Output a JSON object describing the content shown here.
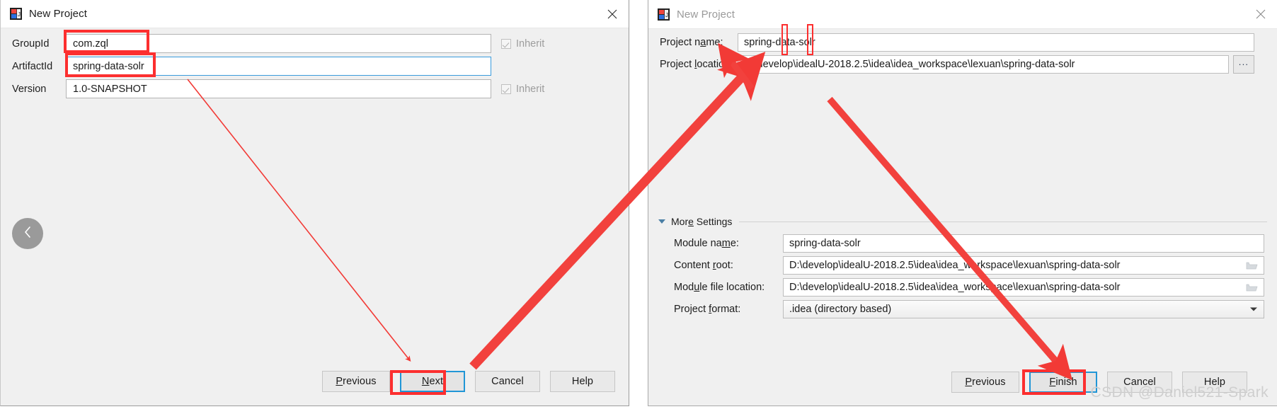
{
  "left_dialog": {
    "title": "New Project",
    "title_icon": "intellij-idea-icon",
    "close_icon": "close-icon",
    "back_icon": "chevron-left-icon",
    "fields": [
      {
        "label": "GroupId",
        "value": "com.zql",
        "inherit_label": "Inherit",
        "has_inherit": true,
        "focused": false
      },
      {
        "label": "ArtifactId",
        "value": "spring-data-solr",
        "inherit_label": "",
        "has_inherit": false,
        "focused": true
      },
      {
        "label": "Version",
        "value": "1.0-SNAPSHOT",
        "inherit_label": "Inherit",
        "has_inherit": true,
        "focused": false
      }
    ],
    "buttons": [
      {
        "label": "Previous",
        "mnemonic": "P",
        "focused": false
      },
      {
        "label": "Next",
        "mnemonic": "N",
        "focused": true
      },
      {
        "label": "Cancel",
        "mnemonic": "",
        "focused": false
      },
      {
        "label": "Help",
        "mnemonic": "",
        "focused": false
      }
    ]
  },
  "right_dialog": {
    "title": "New Project",
    "title_icon": "intellij-idea-icon",
    "close_icon": "close-icon",
    "project_name": {
      "label": "Project name:",
      "mnem_before": "Project n",
      "mnem": "a",
      "mnem_after": "me:",
      "value": "spring-data-solr"
    },
    "project_location": {
      "label": "Project location:",
      "mnem_before": "Project ",
      "mnem": "l",
      "mnem_after": "ocation:",
      "value": "D:\\develop\\idealU-2018.2.5\\idea\\idea_workspace\\lexuan\\spring-data-solr",
      "browse_label": "...",
      "browse_icon": "ellipsis-icon"
    },
    "more_settings": {
      "label": "More Settings",
      "mnem_before": "Mor",
      "mnem": "e",
      "mnem_after": " Settings",
      "expanded": true,
      "toggle_icon": "triangle-down-icon"
    },
    "settings_rows": [
      {
        "label": "Module name:",
        "mnem_before": "Module na",
        "mnem": "m",
        "mnem_after": "e:",
        "value": "spring-data-solr",
        "trailing_icon": "",
        "type": "text"
      },
      {
        "label": "Content root:",
        "mnem_before": "Content ",
        "mnem": "r",
        "mnem_after": "oot:",
        "value": "D:\\develop\\idealU-2018.2.5\\idea\\idea_workspace\\lexuan\\spring-data-solr",
        "trailing_icon": "folder-icon",
        "type": "path"
      },
      {
        "label": "Module file location:",
        "mnem_before": "Mod",
        "mnem": "u",
        "mnem_after": "le file location:",
        "value": "D:\\develop\\idealU-2018.2.5\\idea\\idea_workspace\\lexuan\\spring-data-solr",
        "trailing_icon": "folder-icon",
        "type": "path"
      },
      {
        "label": "Project format:",
        "mnem_before": "Project ",
        "mnem": "f",
        "mnem_after": "ormat:",
        "value": ".idea (directory based)",
        "trailing_icon": "chevron-down-icon",
        "type": "select"
      }
    ],
    "buttons": [
      {
        "label": "Previous",
        "mnemonic": "P",
        "focused": false
      },
      {
        "label": "Finish",
        "mnemonic": "F",
        "focused": true
      },
      {
        "label": "Cancel",
        "mnemonic": "",
        "focused": false
      },
      {
        "label": "Help",
        "mnemonic": "",
        "focused": false
      }
    ]
  },
  "watermark": "CSDN @Daniel521-Spark",
  "annotation": {
    "color": "#fc2f2f",
    "highlight_count": 6,
    "arrow_count": 3
  }
}
